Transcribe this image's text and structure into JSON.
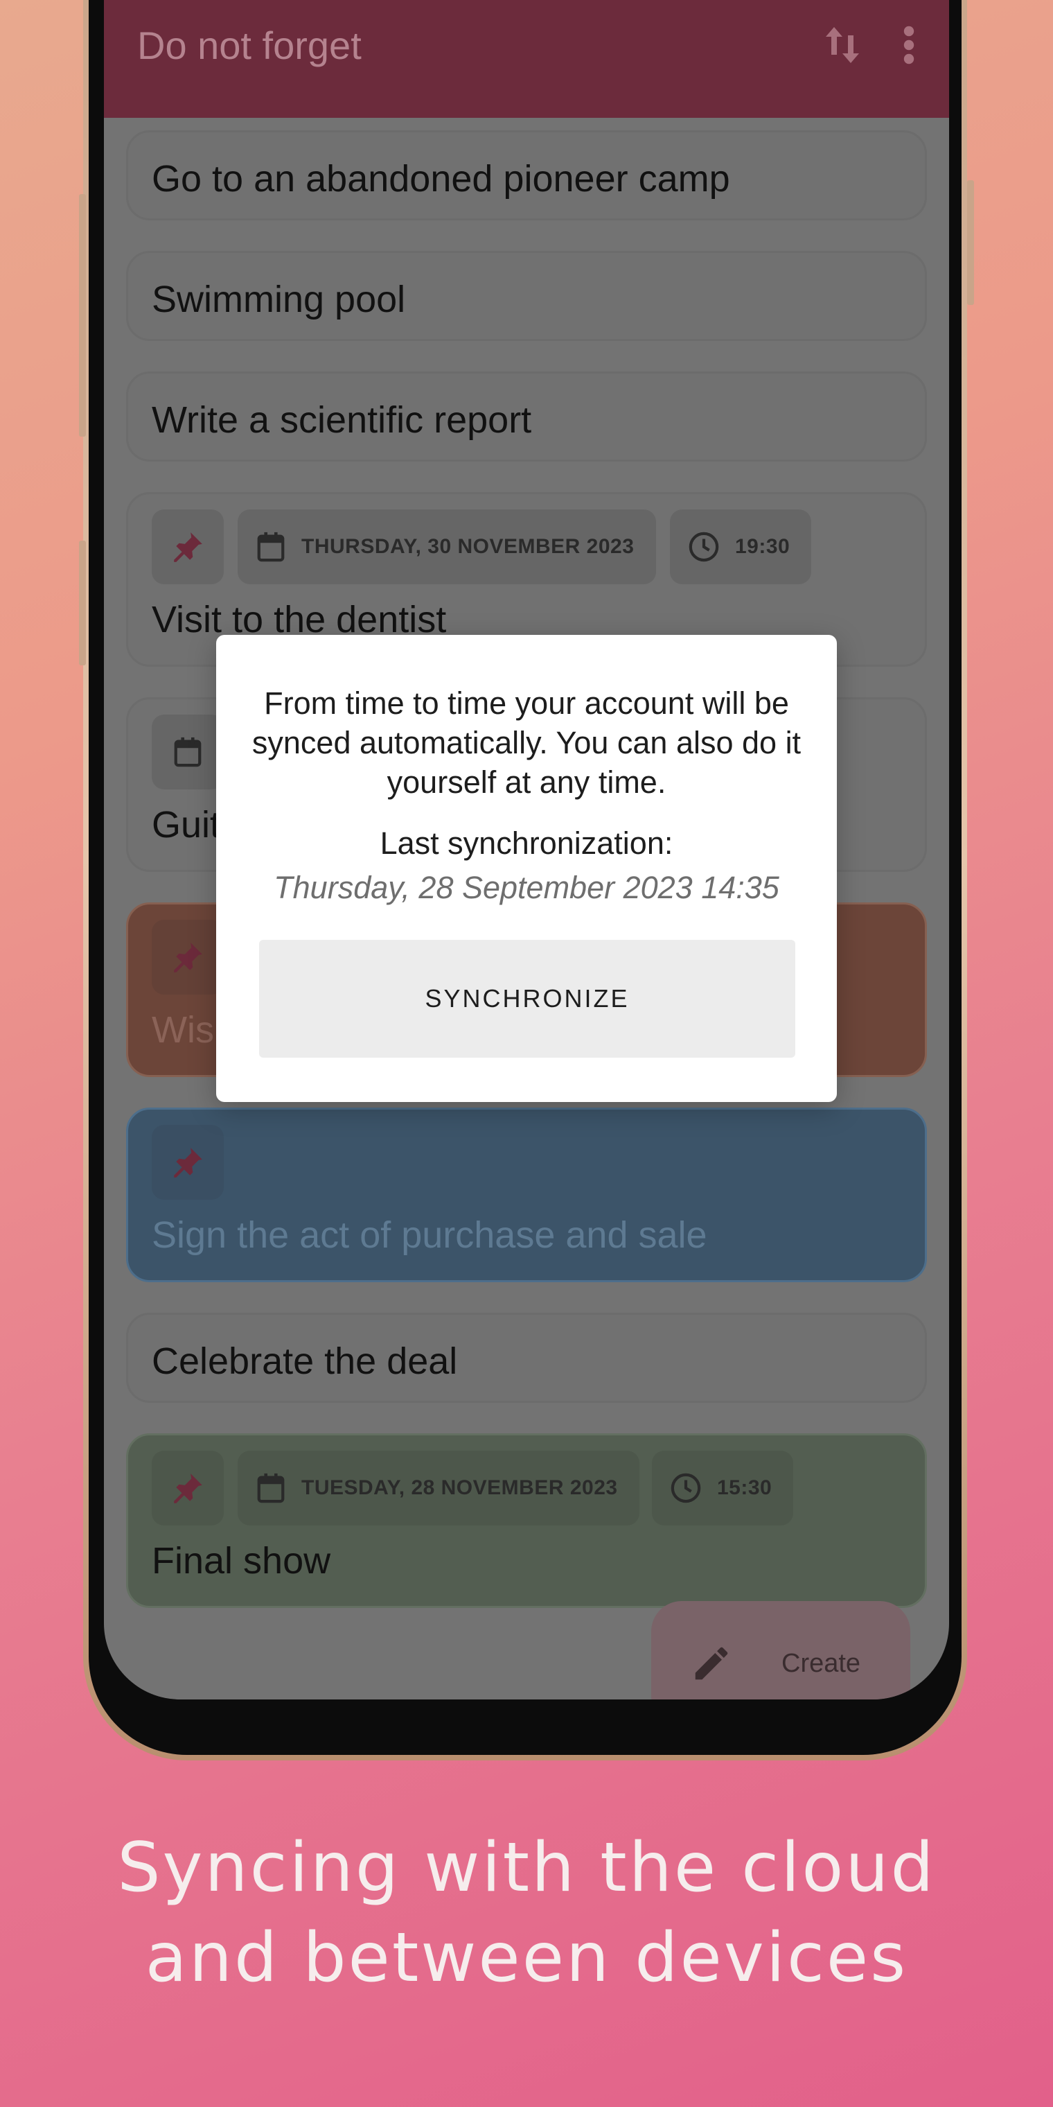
{
  "app": {
    "title": "Do not forget",
    "sort_icon": "sort-arrows-icon",
    "menu_icon": "more-vertical-icon"
  },
  "notes": [
    {
      "title": "Go to an abandoned pioneer camp"
    },
    {
      "title": "Swimming pool"
    },
    {
      "title": "Write a scientific report"
    },
    {
      "title": "Visit to the dentist",
      "date": "THURSDAY, 30 NOVEMBER 2023",
      "time": "19:30",
      "pinned": true
    },
    {
      "title": "Guit"
    },
    {
      "title": "Wis",
      "pinned": true,
      "color": "#e06b4d"
    },
    {
      "title": "Sign the act of purchase and sale",
      "pinned": true,
      "color": "#4a87c4"
    },
    {
      "title": "Celebrate the deal"
    },
    {
      "title": "Final show",
      "date": "TUESDAY, 28 NOVEMBER 2023",
      "time": "15:30",
      "pinned": true,
      "color": "#8fbd8a"
    }
  ],
  "fab": {
    "label": "Create"
  },
  "dialog": {
    "message": "From time to time your account will be synced automatically. You can also do it yourself at any time.",
    "last_sync_label": "Last synchronization:",
    "last_sync_value": "Thursday, 28 September 2023 14:35",
    "button": "SYNCHRONIZE"
  },
  "caption": "Syncing with the cloud and between devices",
  "colors": {
    "app_bar": "#c43a5c",
    "pin": "#d6245a",
    "background_start": "#e8a98e",
    "background_end": "#e2608a"
  }
}
